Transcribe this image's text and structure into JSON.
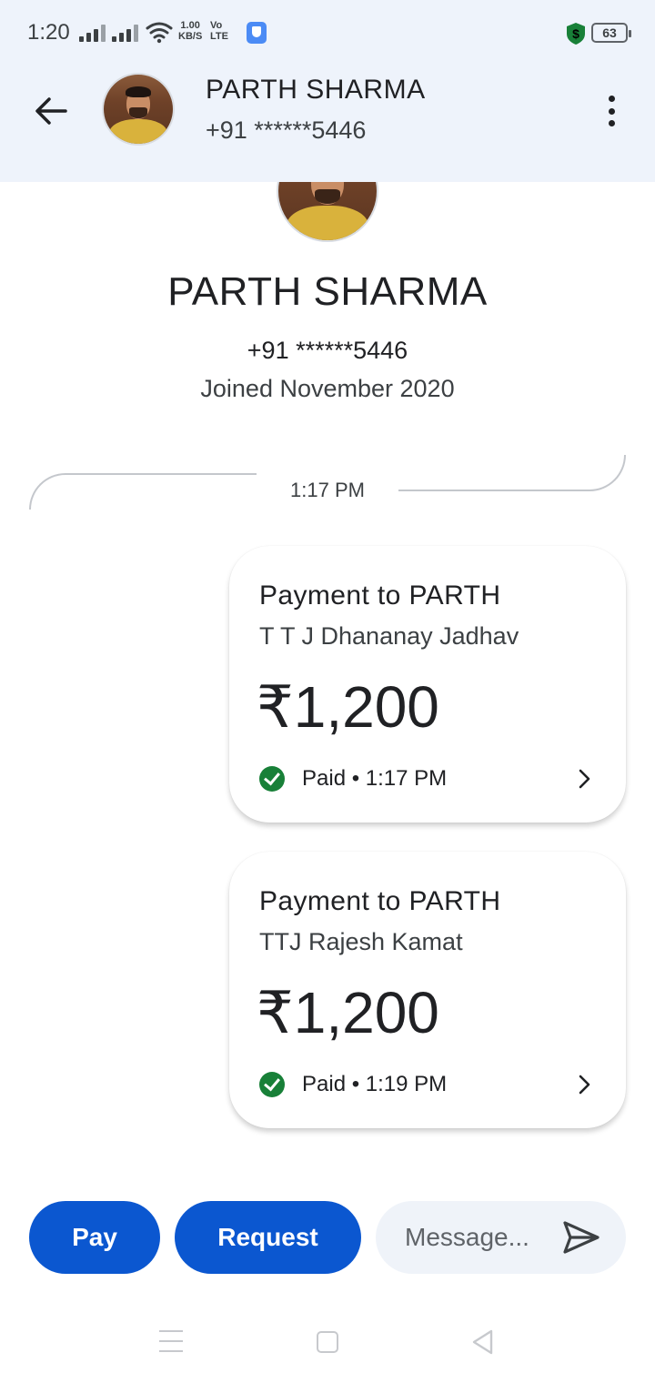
{
  "status_bar": {
    "time": "1:20",
    "speed_value": "1.00",
    "speed_unit": "KB/S",
    "volte_top": "Vo",
    "volte_bottom": "LTE",
    "battery": "63"
  },
  "header": {
    "name": "PARTH SHARMA",
    "phone": "+91 ******5446",
    "back_icon": "arrow-left-icon",
    "menu_icon": "more-vertical-icon"
  },
  "profile": {
    "name": "PARTH SHARMA",
    "phone": "+91 ******5446",
    "joined": "Joined November 2020"
  },
  "divider_time": "1:17 PM",
  "payments": [
    {
      "title": "Payment to PARTH",
      "payer": "T T J Dhananay Jadhav",
      "amount": "₹1,200",
      "status": "Paid • 1:17 PM"
    },
    {
      "title": "Payment to PARTH",
      "payer": "TTJ Rajesh Kamat",
      "amount": "₹1,200",
      "status": "Paid • 1:19 PM"
    }
  ],
  "actions": {
    "pay_label": "Pay",
    "request_label": "Request",
    "message_placeholder": "Message..."
  },
  "colors": {
    "accent": "#0b57d0",
    "paid_green": "#188038",
    "header_bg": "#eef3fb"
  }
}
